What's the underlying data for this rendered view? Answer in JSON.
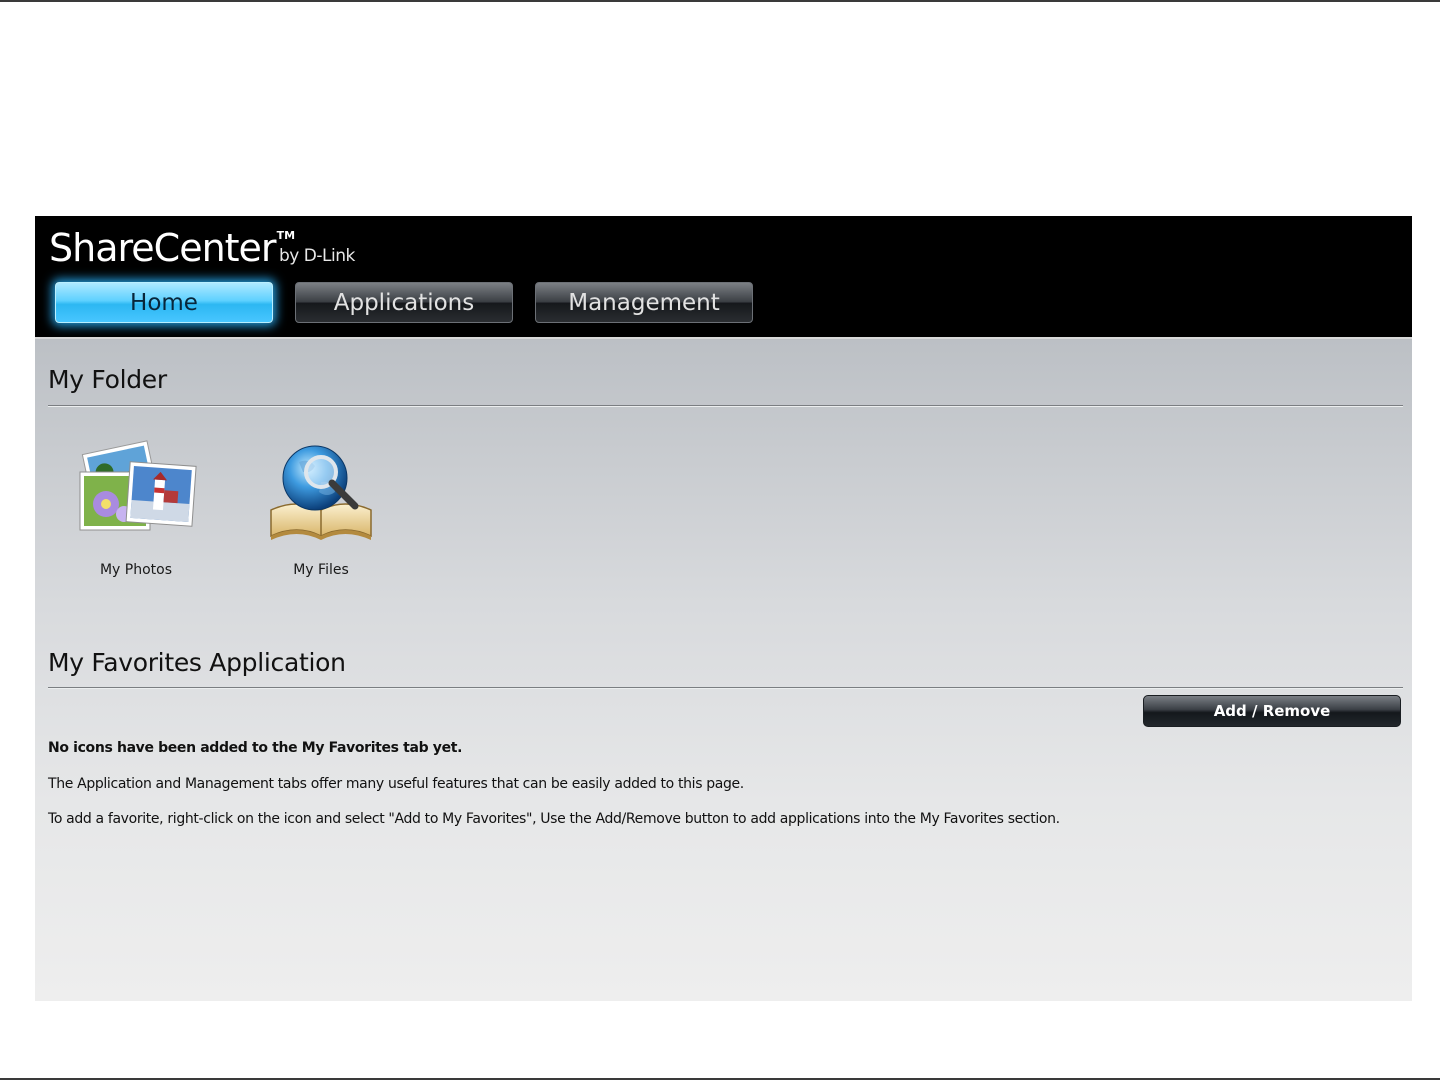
{
  "app": {
    "logo_name": "ShareCenter",
    "logo_tm": "TM",
    "logo_by": "by D-Link"
  },
  "tabs": [
    {
      "label": "Home",
      "active": true
    },
    {
      "label": "Applications",
      "active": false
    },
    {
      "label": "Management",
      "active": false
    }
  ],
  "my_folder": {
    "title": "My Folder",
    "items": [
      {
        "label": "My Photos",
        "icon": "photos-icon"
      },
      {
        "label": "My Files",
        "icon": "globe-book-icon"
      }
    ]
  },
  "favorites": {
    "title": "My Favorites Application",
    "add_remove_label": "Add / Remove",
    "empty_heading": "No icons have been added to the My Favorites tab yet.",
    "line1": "The Application and Management tabs offer many useful features that can be easily added to this page.",
    "line2": "To add a favorite, right-click on the icon and select \"Add to My Favorites\", Use the Add/Remove button to add applications into the My Favorites section."
  },
  "colors": {
    "header_bg": "#000000",
    "active_tab": "#48c6ff",
    "content_bg": "#d8dadd"
  }
}
